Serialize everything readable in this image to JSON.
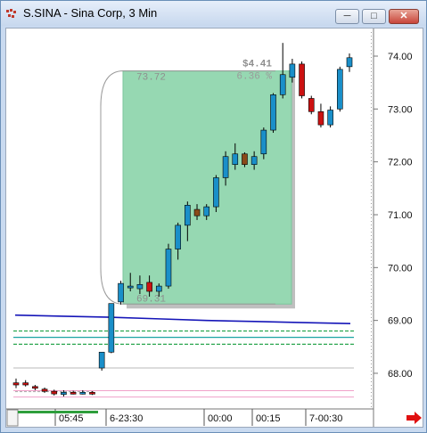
{
  "window": {
    "title": "S.SINA - Sina Corp, 3 Min",
    "minimize_icon": "minimize-icon",
    "maximize_icon": "maximize-icon",
    "close_icon": "close-icon"
  },
  "measure": {
    "dollar_change": "$4.41",
    "percent_change": "6.36 %",
    "top_price": "73.72",
    "bottom_price": "69.31",
    "fill_color": "#96d8b2"
  },
  "chart_data": {
    "type": "candlestick",
    "ylim": [
      67.4,
      74.4
    ],
    "y_ticks": [
      "74.00",
      "73.00",
      "72.00",
      "71.00",
      "70.00",
      "69.00",
      "68.00"
    ],
    "x_ticks": [
      "05:45",
      "6-23:30",
      "00:00",
      "00:15",
      "7-00:30"
    ],
    "up_color": "#1a8fc9",
    "down_color": "#cc1111",
    "candles": [
      {
        "o": 67.82,
        "h": 67.9,
        "l": 67.72,
        "c": 67.78
      },
      {
        "o": 67.82,
        "h": 67.87,
        "l": 67.75,
        "c": 67.78
      },
      {
        "o": 67.75,
        "h": 67.78,
        "l": 67.68,
        "c": 67.72
      },
      {
        "o": 67.7,
        "h": 67.73,
        "l": 67.63,
        "c": 67.66
      },
      {
        "o": 67.66,
        "h": 67.69,
        "l": 67.58,
        "c": 67.61
      },
      {
        "o": 67.6,
        "h": 67.68,
        "l": 67.56,
        "c": 67.64
      },
      {
        "o": 67.64,
        "h": 67.67,
        "l": 67.6,
        "c": 67.63
      },
      {
        "o": 67.63,
        "h": 67.68,
        "l": 67.6,
        "c": 67.64
      },
      {
        "o": 67.64,
        "h": 67.66,
        "l": 67.59,
        "c": 67.62
      },
      {
        "o": 68.1,
        "h": 68.4,
        "l": 68.05,
        "c": 68.4
      },
      {
        "o": 68.4,
        "h": 69.32,
        "l": 68.38,
        "c": 69.32
      },
      {
        "o": 69.35,
        "h": 69.75,
        "l": 69.3,
        "c": 69.7
      },
      {
        "o": 69.62,
        "h": 69.9,
        "l": 69.55,
        "c": 69.65
      },
      {
        "o": 69.6,
        "h": 69.85,
        "l": 69.5,
        "c": 69.68
      },
      {
        "o": 69.72,
        "h": 69.85,
        "l": 69.45,
        "c": 69.55
      },
      {
        "o": 69.55,
        "h": 69.7,
        "l": 69.45,
        "c": 69.65
      },
      {
        "o": 69.65,
        "h": 70.45,
        "l": 69.6,
        "c": 70.35
      },
      {
        "o": 70.35,
        "h": 70.85,
        "l": 70.15,
        "c": 70.8
      },
      {
        "o": 70.8,
        "h": 71.25,
        "l": 70.5,
        "c": 71.18
      },
      {
        "o": 71.1,
        "h": 71.2,
        "l": 70.9,
        "c": 70.98
      },
      {
        "o": 70.98,
        "h": 71.2,
        "l": 70.9,
        "c": 71.15
      },
      {
        "o": 71.15,
        "h": 71.75,
        "l": 71.05,
        "c": 71.7
      },
      {
        "o": 71.7,
        "h": 72.2,
        "l": 71.55,
        "c": 72.1
      },
      {
        "o": 71.95,
        "h": 72.35,
        "l": 71.85,
        "c": 72.15
      },
      {
        "o": 72.15,
        "h": 72.18,
        "l": 71.9,
        "c": 71.95
      },
      {
        "o": 71.95,
        "h": 72.2,
        "l": 71.85,
        "c": 72.1
      },
      {
        "o": 72.15,
        "h": 72.65,
        "l": 72.05,
        "c": 72.6
      },
      {
        "o": 72.6,
        "h": 73.3,
        "l": 72.55,
        "c": 73.27
      },
      {
        "o": 73.27,
        "h": 74.25,
        "l": 73.2,
        "c": 73.65
      },
      {
        "o": 73.6,
        "h": 73.95,
        "l": 73.5,
        "c": 73.85
      },
      {
        "o": 73.85,
        "h": 73.9,
        "l": 73.2,
        "c": 73.25
      },
      {
        "o": 73.2,
        "h": 73.25,
        "l": 72.9,
        "c": 72.95
      },
      {
        "o": 72.95,
        "h": 73.1,
        "l": 72.65,
        "c": 72.7
      },
      {
        "o": 72.7,
        "h": 73.05,
        "l": 72.65,
        "c": 72.98
      },
      {
        "o": 73.0,
        "h": 73.8,
        "l": 72.95,
        "c": 73.75
      },
      {
        "o": 73.8,
        "h": 74.05,
        "l": 73.7,
        "c": 73.97
      }
    ],
    "blue_line": [
      69.1,
      69.08,
      69.06,
      69.03,
      69.0,
      68.98,
      68.96,
      68.94
    ],
    "green_lines": [
      68.8,
      68.68,
      68.55
    ],
    "pink_lines": [
      67.67,
      67.55
    ],
    "gray_line": 68.1
  },
  "footer": {
    "scroll_arrow_icon": "red-arrow-right-icon"
  }
}
